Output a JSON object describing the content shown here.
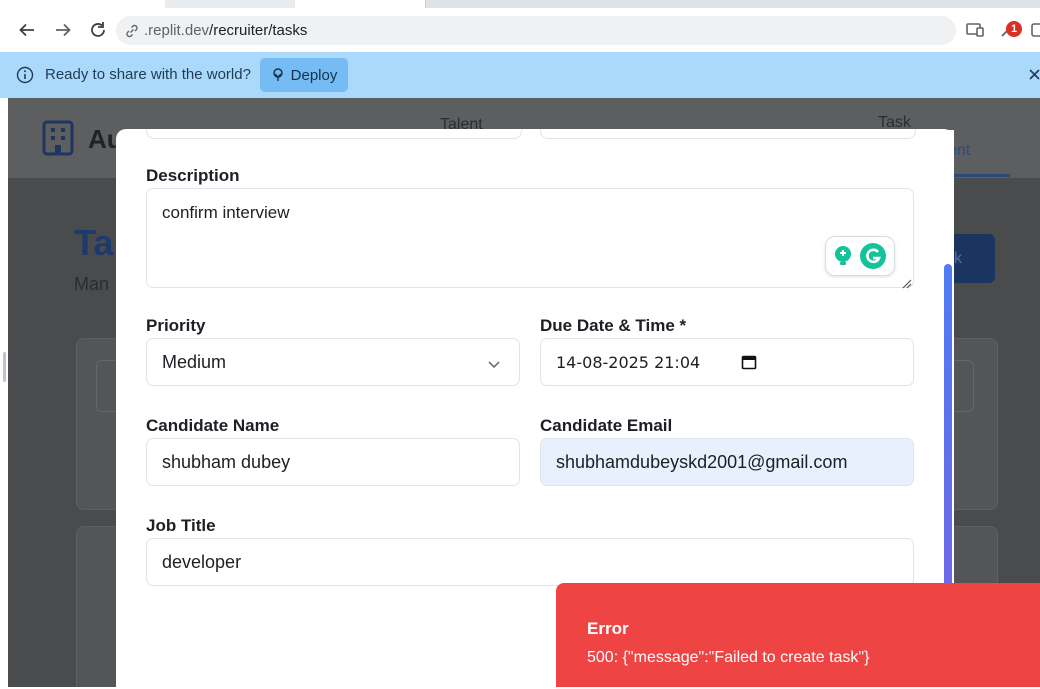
{
  "browser": {
    "url_prefix": ".replit.dev",
    "url_path": "/recruiter/tasks",
    "extension_badge": "1"
  },
  "infobar": {
    "message": "Ready to share with the world?",
    "deploy_label": "Deploy"
  },
  "app_background": {
    "brand_partial": "Au",
    "nav_talent": "Talent",
    "nav_task_top": "Task",
    "nav_task_bottom": "ent",
    "title_partial": "Ta",
    "subtitle_partial": "Man",
    "add_button_partial": "sk"
  },
  "form": {
    "description_label": "Description",
    "description_value": "confirm interview",
    "priority_label": "Priority",
    "priority_value": "Medium",
    "due_label": "Due Date & Time *",
    "due_value": "14-08-2025 21:04",
    "candidate_name_label": "Candidate Name",
    "candidate_name_value": "shubham dubey",
    "candidate_email_label": "Candidate Email",
    "candidate_email_value": "shubhamdubeyskd2001@gmail.com",
    "job_title_label": "Job Title",
    "job_title_value": "developer"
  },
  "toast": {
    "title": "Error",
    "message": "500: {\"message\":\"Failed to create task\"}"
  },
  "colors": {
    "infobar_bg": "#abd9fb",
    "deploy_bg": "#74bcf3",
    "toast_bg": "#ef4444",
    "autofill_bg": "#e8f0fe",
    "scrollbar": "#4d7cf3"
  }
}
